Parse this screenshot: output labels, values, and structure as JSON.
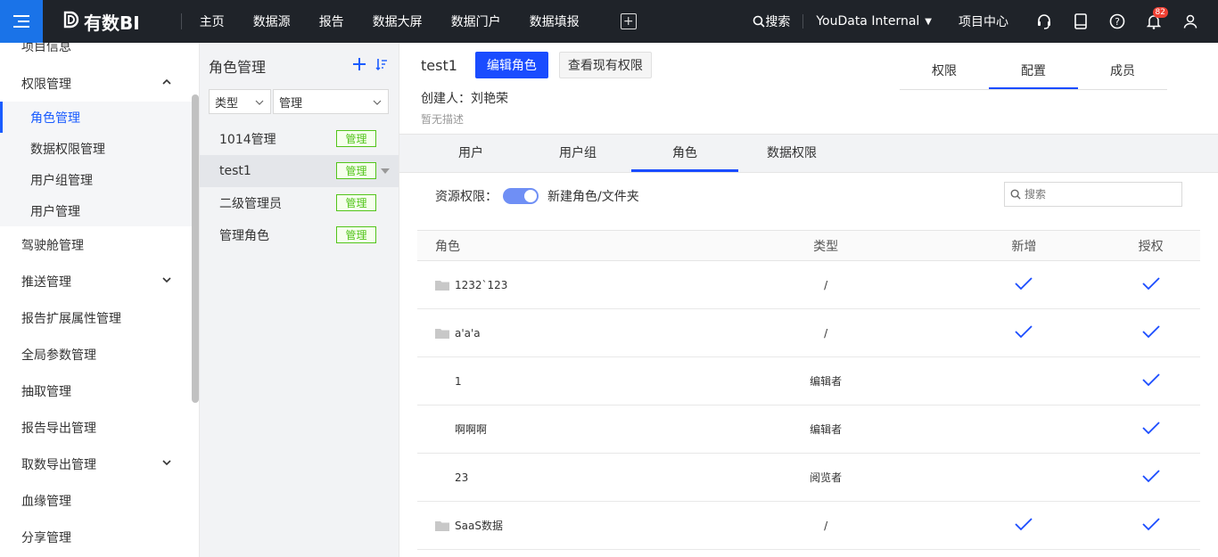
{
  "topnav": {
    "logo": "有数BI",
    "items": [
      "主页",
      "数据源",
      "报告",
      "数据大屏",
      "数据门户",
      "数据填报"
    ],
    "search": "搜索",
    "org": "YouData Internal",
    "project_center": "项目中心",
    "notification_count": "82"
  },
  "sidebar": {
    "items": [
      {
        "label": "项目信息"
      },
      {
        "label": "权限管理",
        "expanded": true
      },
      {
        "label": "驾驶舱管理"
      },
      {
        "label": "推送管理"
      },
      {
        "label": "报告扩展属性管理"
      },
      {
        "label": "全局参数管理"
      },
      {
        "label": "抽取管理"
      },
      {
        "label": "报告导出管理"
      },
      {
        "label": "取数导出管理"
      },
      {
        "label": "血缘管理"
      },
      {
        "label": "分享管理"
      }
    ],
    "subitems": [
      "角色管理",
      "数据权限管理",
      "用户组管理",
      "用户管理"
    ]
  },
  "rolepanel": {
    "title": "角色管理",
    "filter_type": "类型",
    "filter_value": "管理",
    "roles": [
      {
        "name": "1014管理",
        "tag": "管理"
      },
      {
        "name": "test1",
        "tag": "管理"
      },
      {
        "name": "二级管理员",
        "tag": "管理"
      },
      {
        "name": "管理角色",
        "tag": "管理"
      }
    ]
  },
  "main": {
    "role_name": "test1",
    "edit_button": "编辑角色",
    "view_button": "查看现有权限",
    "creator": "创建人：刘艳荣",
    "description": "暂无描述",
    "top_tabs": [
      "权限",
      "配置",
      "成员"
    ],
    "sub_tabs": [
      "用户",
      "用户组",
      "角色",
      "数据权限"
    ],
    "resource_label": "资源权限：",
    "new_label": "新建角色/文件夹",
    "search_placeholder": "搜索",
    "table": {
      "headers": [
        "角色",
        "类型",
        "新增",
        "授权"
      ],
      "rows": [
        {
          "name": "1232`123",
          "type": "/",
          "add": true,
          "grant": true,
          "folder": true
        },
        {
          "name": "a'a'a",
          "type": "/",
          "add": true,
          "grant": true,
          "folder": true
        },
        {
          "name": "1",
          "type": "编辑者",
          "add": false,
          "grant": true,
          "folder": false
        },
        {
          "name": "啊啊啊",
          "type": "编辑者",
          "add": false,
          "grant": true,
          "folder": false
        },
        {
          "name": "23",
          "type": "阅览者",
          "add": false,
          "grant": true,
          "folder": false
        },
        {
          "name": "SaaS数据",
          "type": "/",
          "add": true,
          "grant": true,
          "folder": true
        }
      ]
    }
  },
  "colors": {
    "accent": "#1a4cff",
    "topbar": "#1f2329",
    "tag_green": "#52c41a"
  }
}
